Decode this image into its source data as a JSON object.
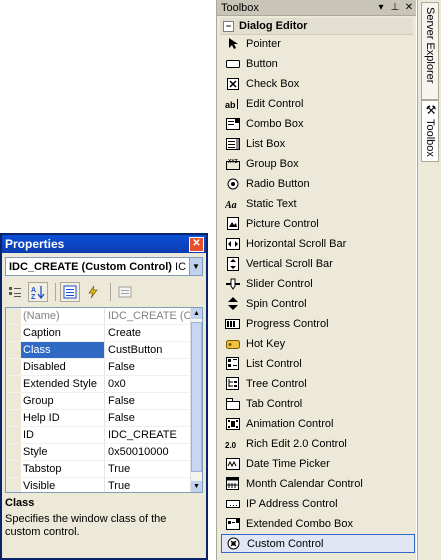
{
  "toolbox": {
    "title": "Toolbox",
    "title_buttons": [
      "▾",
      "⊥",
      "✕"
    ],
    "section": "Dialog Editor",
    "items": [
      {
        "label": "Pointer",
        "icon": "pointer-icon"
      },
      {
        "label": "Button",
        "icon": "button-icon"
      },
      {
        "label": "Check Box",
        "icon": "check-box-icon"
      },
      {
        "label": "Edit Control",
        "icon": "edit-control-icon"
      },
      {
        "label": "Combo Box",
        "icon": "combo-box-icon"
      },
      {
        "label": "List Box",
        "icon": "list-box-icon"
      },
      {
        "label": "Group Box",
        "icon": "group-box-icon"
      },
      {
        "label": "Radio Button",
        "icon": "radio-button-icon"
      },
      {
        "label": "Static Text",
        "icon": "static-text-icon"
      },
      {
        "label": "Picture Control",
        "icon": "picture-control-icon"
      },
      {
        "label": "Horizontal Scroll Bar",
        "icon": "horizontal-scroll-bar-icon"
      },
      {
        "label": "Vertical Scroll Bar",
        "icon": "vertical-scroll-bar-icon"
      },
      {
        "label": "Slider Control",
        "icon": "slider-control-icon"
      },
      {
        "label": "Spin Control",
        "icon": "spin-control-icon"
      },
      {
        "label": "Progress Control",
        "icon": "progress-control-icon"
      },
      {
        "label": "Hot Key",
        "icon": "hot-key-icon"
      },
      {
        "label": "List Control",
        "icon": "list-control-icon"
      },
      {
        "label": "Tree Control",
        "icon": "tree-control-icon"
      },
      {
        "label": "Tab Control",
        "icon": "tab-control-icon"
      },
      {
        "label": "Animation Control",
        "icon": "animation-control-icon"
      },
      {
        "label": "Rich Edit 2.0 Control",
        "icon": "rich-edit-icon"
      },
      {
        "label": "Date Time Picker",
        "icon": "date-time-picker-icon"
      },
      {
        "label": "Month Calendar Control",
        "icon": "month-calendar-icon"
      },
      {
        "label": "IP Address Control",
        "icon": "ip-address-icon"
      },
      {
        "label": "Extended Combo Box",
        "icon": "extended-combo-box-icon"
      },
      {
        "label": "Custom Control",
        "icon": "custom-control-icon",
        "selected": true
      }
    ]
  },
  "side_tabs": {
    "server_explorer": "Server Explorer",
    "toolbox": "Toolbox"
  },
  "properties": {
    "title": "Properties",
    "object": "IDC_CREATE (Custom Control) ",
    "object_suffix": "IC",
    "rows": [
      {
        "name": "(Name)",
        "value": "IDC_CREATE (Cus",
        "dim": true
      },
      {
        "name": "Caption",
        "value": "Create"
      },
      {
        "name": "Class",
        "value": "CustButton",
        "selected": true
      },
      {
        "name": "Disabled",
        "value": "False"
      },
      {
        "name": "Extended Style",
        "value": "0x0"
      },
      {
        "name": "Group",
        "value": "False"
      },
      {
        "name": "Help ID",
        "value": "False"
      },
      {
        "name": "ID",
        "value": "IDC_CREATE"
      },
      {
        "name": "Style",
        "value": "0x50010000"
      },
      {
        "name": "Tabstop",
        "value": "True"
      },
      {
        "name": "Visible",
        "value": "True"
      }
    ],
    "description_title": "Class",
    "description_text": "Specifies the window class of the custom control."
  }
}
